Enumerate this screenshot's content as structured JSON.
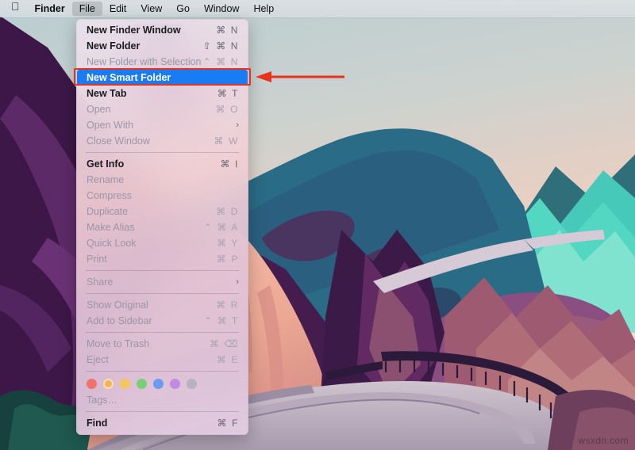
{
  "menubar": {
    "apple_icon": "apple-logo-icon",
    "items": [
      {
        "label": "Finder",
        "bold": true,
        "active": false
      },
      {
        "label": "File",
        "bold": false,
        "active": true
      },
      {
        "label": "Edit",
        "bold": false,
        "active": false
      },
      {
        "label": "View",
        "bold": false,
        "active": false
      },
      {
        "label": "Go",
        "bold": false,
        "active": false
      },
      {
        "label": "Window",
        "bold": false,
        "active": false
      },
      {
        "label": "Help",
        "bold": false,
        "active": false
      }
    ]
  },
  "file_menu": {
    "title": "File",
    "rows": [
      {
        "type": "item",
        "label": "New Finder Window",
        "shortcut": "⌘ N",
        "state": "normal"
      },
      {
        "type": "item",
        "label": "New Folder",
        "shortcut": "⇧ ⌘ N",
        "state": "normal"
      },
      {
        "type": "item",
        "label": "New Folder with Selection",
        "shortcut": "⌃ ⌘ N",
        "state": "disabled"
      },
      {
        "type": "item",
        "label": "New Smart Folder",
        "shortcut": "",
        "state": "selected"
      },
      {
        "type": "item",
        "label": "New Tab",
        "shortcut": "⌘ T",
        "state": "normal"
      },
      {
        "type": "item",
        "label": "Open",
        "shortcut": "⌘ O",
        "state": "disabled"
      },
      {
        "type": "item",
        "label": "Open With",
        "shortcut": "",
        "state": "disabled",
        "submenu": true
      },
      {
        "type": "item",
        "label": "Close Window",
        "shortcut": "⌘ W",
        "state": "disabled"
      },
      {
        "type": "separator"
      },
      {
        "type": "item",
        "label": "Get Info",
        "shortcut": "⌘ I",
        "state": "normal"
      },
      {
        "type": "item",
        "label": "Rename",
        "shortcut": "",
        "state": "disabled"
      },
      {
        "type": "item",
        "label": "Compress",
        "shortcut": "",
        "state": "disabled"
      },
      {
        "type": "item",
        "label": "Duplicate",
        "shortcut": "⌘ D",
        "state": "disabled"
      },
      {
        "type": "item",
        "label": "Make Alias",
        "shortcut": "⌃ ⌘ A",
        "state": "disabled"
      },
      {
        "type": "item",
        "label": "Quick Look",
        "shortcut": "⌘ Y",
        "state": "disabled"
      },
      {
        "type": "item",
        "label": "Print",
        "shortcut": "⌘ P",
        "state": "disabled"
      },
      {
        "type": "separator"
      },
      {
        "type": "item",
        "label": "Share",
        "shortcut": "",
        "state": "disabled",
        "submenu": true
      },
      {
        "type": "separator"
      },
      {
        "type": "item",
        "label": "Show Original",
        "shortcut": "⌘ R",
        "state": "disabled"
      },
      {
        "type": "item",
        "label": "Add to Sidebar",
        "shortcut": "⌃ ⌘ T",
        "state": "disabled"
      },
      {
        "type": "separator"
      },
      {
        "type": "item",
        "label": "Move to Trash",
        "shortcut": "⌘ ⌫",
        "state": "disabled"
      },
      {
        "type": "item",
        "label": "Eject",
        "shortcut": "⌘ E",
        "state": "disabled"
      },
      {
        "type": "separator"
      },
      {
        "type": "tags"
      },
      {
        "type": "item",
        "label": "Tags…",
        "shortcut": "",
        "state": "disabled"
      },
      {
        "type": "separator"
      },
      {
        "type": "item",
        "label": "Find",
        "shortcut": "⌘ F",
        "state": "normal"
      }
    ],
    "tag_colors": [
      {
        "name": "red-tag",
        "hex": "#f0736a",
        "selected": false
      },
      {
        "name": "orange-tag",
        "hex": "#f0b45c",
        "selected": true
      },
      {
        "name": "yellow-tag",
        "hex": "#f2c75c",
        "selected": false
      },
      {
        "name": "green-tag",
        "hex": "#79cf77",
        "selected": false
      },
      {
        "name": "blue-tag",
        "hex": "#6a9bee",
        "selected": false
      },
      {
        "name": "purple-tag",
        "hex": "#c08ae6",
        "selected": false
      },
      {
        "name": "gray-tag",
        "hex": "#b5b3bb",
        "selected": false
      }
    ],
    "selected_item": "New Smart Folder"
  },
  "annotation": {
    "highlight_color": "#e8321c",
    "target": "New Smart Folder",
    "arrow_direction": "left"
  },
  "desktop": {
    "wallpaper_name": "big-sur-road-mountains",
    "watermark": "wsxdn.com"
  }
}
